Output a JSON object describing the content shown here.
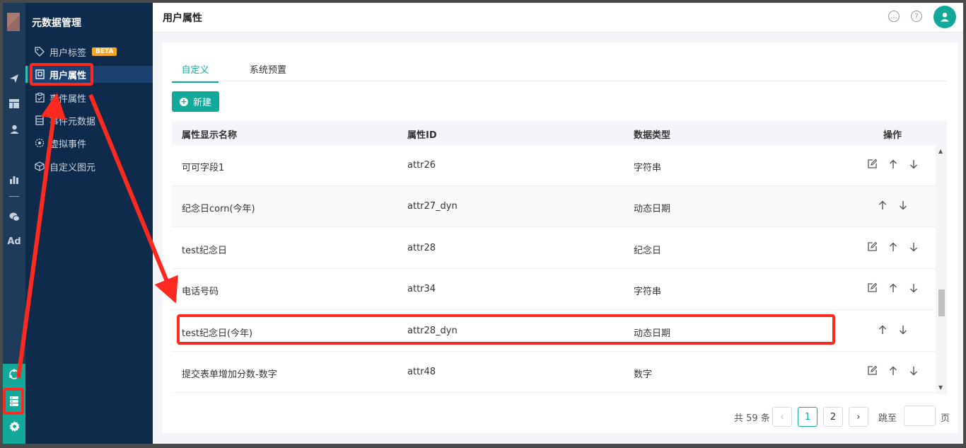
{
  "sidebar": {
    "title": "元数据管理",
    "items": [
      {
        "label": "用户标签",
        "badge": "BETA",
        "icon": "tag-icon"
      },
      {
        "label": "用户属性",
        "icon": "user-attr-icon",
        "active": true
      },
      {
        "label": "事件属性",
        "icon": "clipboard-icon"
      },
      {
        "label": "事件元数据",
        "icon": "database-icon"
      },
      {
        "label": "虚拟事件",
        "icon": "virtual-event-icon"
      },
      {
        "label": "自定义图元",
        "icon": "cube-icon"
      }
    ]
  },
  "rail": {
    "icons": [
      "send-icon",
      "dashboard-icon",
      "user-icon",
      "bar-chart-icon",
      "wechat-icon",
      "ad-icon",
      "network-icon",
      "server-icon",
      "gear-icon"
    ],
    "ad_label": "Ad"
  },
  "header": {
    "title": "用户属性",
    "icons": [
      "chat-icon",
      "help-icon",
      "avatar-icon"
    ]
  },
  "tabs": [
    {
      "label": "自定义",
      "active": true
    },
    {
      "label": "系统预置",
      "active": false
    }
  ],
  "new_button": {
    "label": "新建"
  },
  "table": {
    "columns": [
      "属性显示名称",
      "属性ID",
      "数据类型",
      "操作"
    ],
    "rows": [
      {
        "name": "可可字段1",
        "id": "attr26",
        "type": "字符串",
        "editable": true
      },
      {
        "name": "纪念日corn(今年)",
        "id": "attr27_dyn",
        "type": "动态日期",
        "editable": false
      },
      {
        "name": "test纪念日",
        "id": "attr28",
        "type": "纪念日",
        "editable": true
      },
      {
        "name": "电话号码",
        "id": "attr34",
        "type": "字符串",
        "editable": true
      },
      {
        "name": "test纪念日(今年)",
        "id": "attr28_dyn",
        "type": "动态日期",
        "editable": false
      },
      {
        "name": "提交表单增加分数-数字",
        "id": "attr48",
        "type": "数字",
        "editable": true
      }
    ]
  },
  "pagination": {
    "total": "共 59 条",
    "pages": [
      "1",
      "2"
    ],
    "current": "1",
    "jump_label": "跳至",
    "page_label": "页",
    "prev": "‹",
    "next": "›"
  },
  "colors": {
    "accent": "#13a99a",
    "sidebar_bg": "#0f2b4c",
    "rail_bg": "#1f3b5a",
    "annotation": "#ff2a1f"
  }
}
